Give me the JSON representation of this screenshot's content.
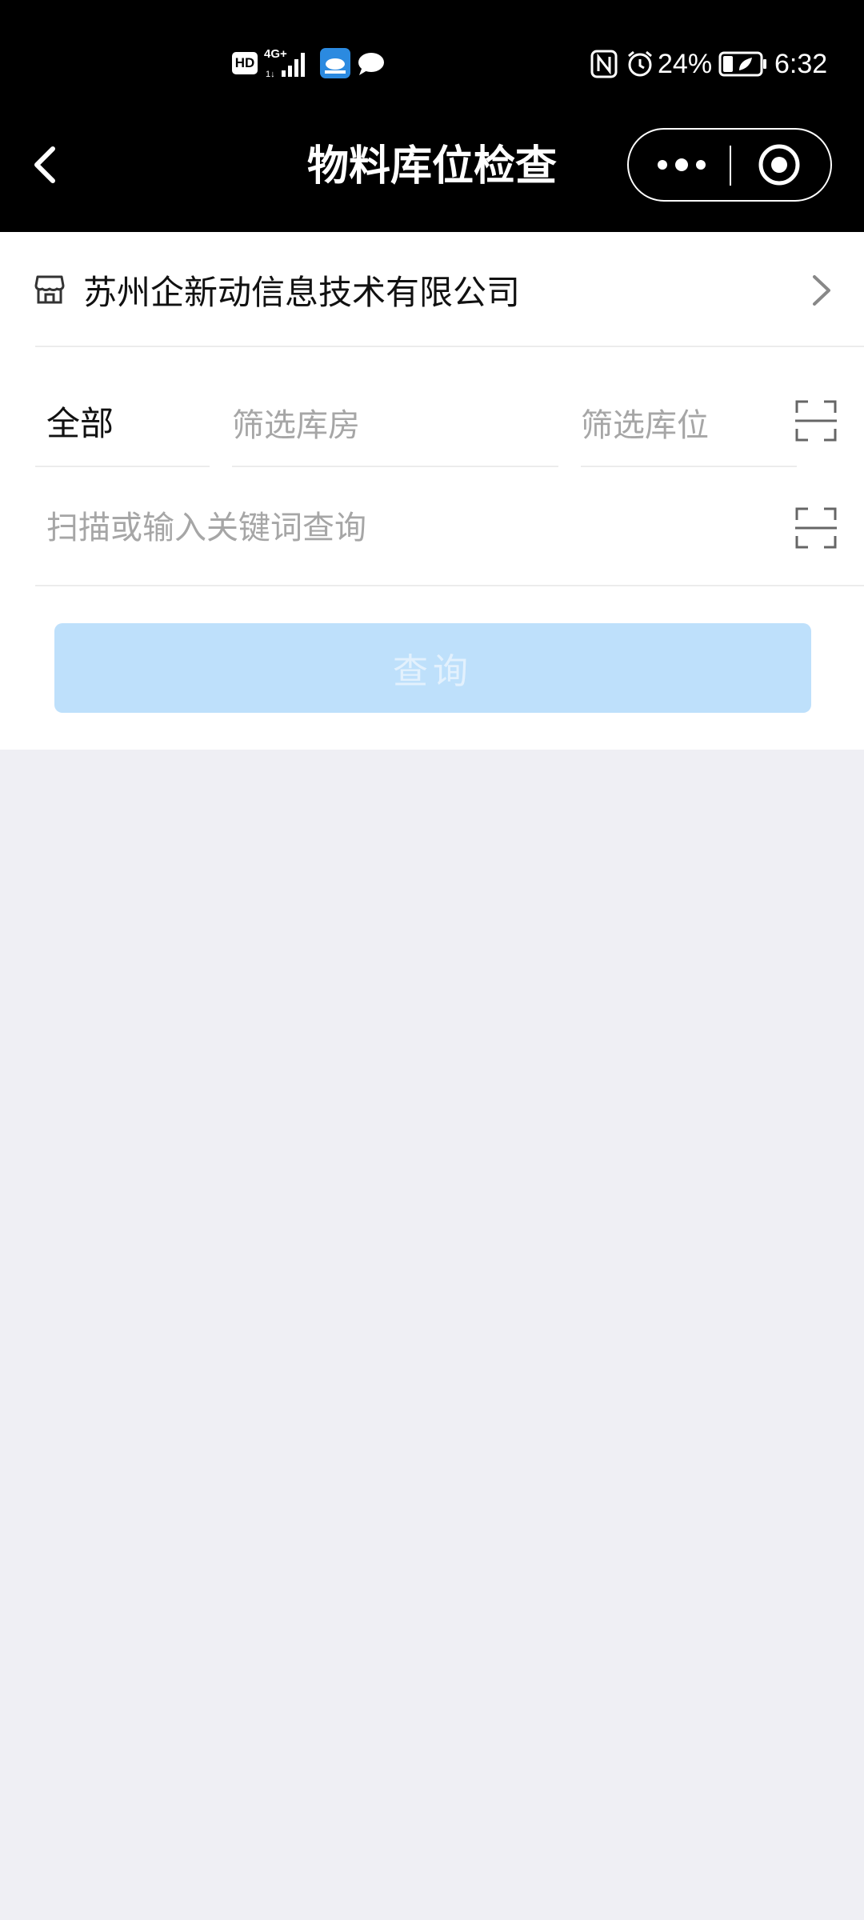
{
  "status_bar": {
    "hd_badge": "HD",
    "network": "4G+",
    "battery": "24%",
    "time": "6:32"
  },
  "nav": {
    "title": "物料库位检查"
  },
  "company": {
    "name": "苏州企新动信息技术有限公司"
  },
  "filters": {
    "scope_label": "全部",
    "warehouse_placeholder": "筛选库房",
    "location_placeholder": "筛选库位"
  },
  "search": {
    "placeholder": "扫描或输入关键词查询"
  },
  "actions": {
    "query_label": "查询"
  },
  "colors": {
    "bar_bg": "#000000",
    "page_bg": "#efeff4",
    "card_bg": "#ffffff",
    "button_disabled_bg": "#bee0fb",
    "placeholder": "#a6a6a6"
  }
}
